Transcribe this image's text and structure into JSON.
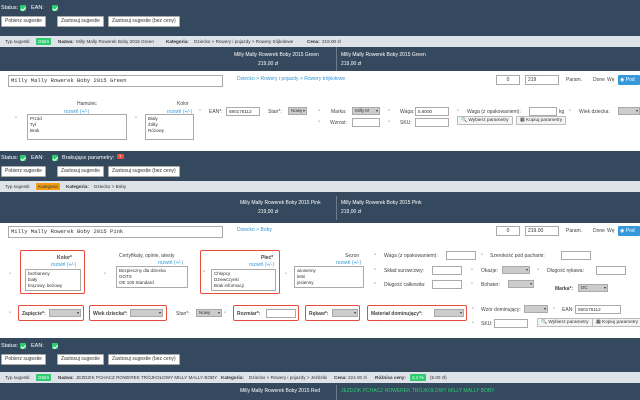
{
  "labels": {
    "status": "Status:",
    "ean": "EAN:",
    "missing": "Brakujące parametry:",
    "missing_count": "7"
  },
  "buttons": {
    "get_suggestions": "Pobierz sugestie",
    "apply_suggestions": "Zastosuj sugestie",
    "apply_no_price": "Zastosuj sugestie (bez ceny)",
    "pick_params": "Wybierz parametry",
    "copy_params": "Kopiuj parametry",
    "add": "Pod"
  },
  "strip_labels": {
    "type": "Typ sugestii:",
    "name": "Nazwa:",
    "category": "Kategoria:",
    "price": "Cena:",
    "margin": "Różnica ceny:"
  },
  "param_labels": {
    "param": "Param.",
    "param_short": "Param.",
    "done": "Done",
    "done_short": "Done",
    "we": "Wę"
  },
  "p1": {
    "type": "Ostro",
    "name": "Milly Mally Rowerek Boby 2015 Green",
    "category": "Dziecko > Rowery i pojazdy > Rowery trójkołowe",
    "price": "219.00 zł",
    "col1_name": "Milly Mally Rowerek Boby 2015 Green",
    "col1_price": "219,00 zł",
    "col2_name": "Milly Mally Rowerek Boby 2015 Green",
    "col2_price": "219,00 zł",
    "edit_name": "Milly Mally Rowerek Boby 2015 Green",
    "edit_category": "Dziecko > Rowery i pojazdy > Rowery trójkołowe",
    "qty": "0",
    "edit_price": "219",
    "hamulec_label": "Hamulec",
    "hamulec_options": [
      "Przód",
      "Tył",
      "Brak"
    ],
    "kolor_label": "Kolor",
    "kolor_options": [
      "Biały",
      "Żółty",
      "Różowy"
    ],
    "expand": "rozwiń (+/-)",
    "ean_label": "EAN*:",
    "ean_value": "590176112",
    "stan_label": "Stan*:",
    "stan_value": "Nowy",
    "marka_label": "Marka:",
    "marka_value": "Milly M",
    "wzrost_label": "Wzrost:",
    "waga_label": "Waga:",
    "waga_value": "5.8000",
    "sku_label": "SKU:",
    "waga_opak_label": "Waga (z opakowaniem):",
    "wiek_label": "Wiek dziecka:",
    "kg": "kg"
  },
  "p2": {
    "type": "Kategoria",
    "category": "Dziecko > Boby",
    "col1_name": "Milly Mally Rowerek Boby 2015 Pink",
    "col1_price": "219,00 zł",
    "col2_name": "Milly Mally Rowerek Boby 2015 Pink",
    "col2_price": "219,00 zł",
    "edit_name": "Milly Mally Rowerek Boby 2015 Pink",
    "edit_category": "Dziecko > Boby",
    "qty": "0",
    "edit_price": "219.00",
    "kolor_label": "Kolor*",
    "kolor_options": [
      "bezbarwny",
      "biały",
      "brązowy, beżowy"
    ],
    "cert_label": "Certyfikaty, opinie, atesty",
    "cert_options": [
      "Bezpieczny dla dziecka",
      "GOTS",
      "OE 100 Standard"
    ],
    "plec_label": "Płeć*",
    "plec_options": [
      "Chłopcy",
      "Dziewczynki",
      "Brak informacji"
    ],
    "sezon_label": "Sezon",
    "sezon_options": [
      "wiosenny",
      "letni",
      "jesienny"
    ],
    "expand": "rozwiń (+/-)",
    "waga_label": "Waga (z opakowaniem):",
    "szer_label": "Szerokość pod pachami:",
    "sklad_label": "Skład surowcowy:",
    "okazje_label": "Okazje:",
    "dlugosc_rek_label": "Długość rękawa:",
    "dlugosc_label": "Długość całkowita:",
    "bohater_label": "Bohater:",
    "marka_label": "Marka*:",
    "marka_value": "DC",
    "zapiecie_label": "Zapięcie*:",
    "wiek_label": "Wiek dziecka*:",
    "stan_label": "Stan*:",
    "stan_value": "Nowy",
    "rozmiar_label": "Rozmiar*:",
    "rekaw_label": "Rękaw*:",
    "material_label": "Materiał dominujący*:",
    "wzor_label": "Wzór dominujący:",
    "ean_label": "EAN:",
    "ean_value": "590176112",
    "sku_label": "SKU:"
  },
  "p3": {
    "type": "Ostro",
    "name": "JEZDZIK PCHACZ ROWEREK TRÓJKOŁOWY MILLY MALLY BOBY",
    "category": "Dziecko > Rowery i pojazdy > Jeździki",
    "price": "224.00 zł",
    "margin": "2.2 %",
    "margin_value": "(5.00 zł)",
    "col1_name": "Milly Mally Rowerek Boby 2015 Red",
    "col2_name": "JEZDZIK PCHACZ ROWEREK TRÓJKOŁOWY MILLY MALLY BOBY"
  },
  "colors": {
    "dark": "#34495e",
    "green": "#2ecc71",
    "orange": "#f39c12",
    "red": "#e74c3c",
    "blue": "#3498db"
  }
}
